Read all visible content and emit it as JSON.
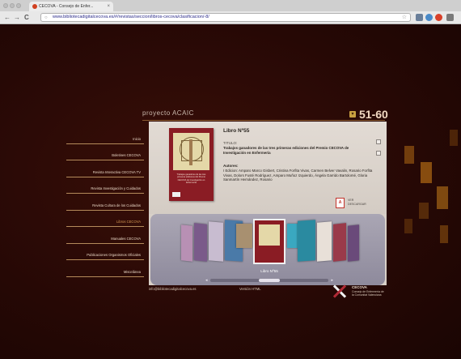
{
  "browser": {
    "tab_title": "CECOVA - Consejo de Enfer...",
    "tab_close": "×",
    "url": "www.bibliotecadigitalcecova.es/#/revistas/seccion/libros-cecova/clasificacion/-8/",
    "back": "←",
    "forward": "→",
    "reload": "C",
    "lock": "○",
    "star": "☆"
  },
  "header": {
    "project_label": "proyecto ACAIC",
    "range_label": "51-60",
    "range_arrow": "▾"
  },
  "menu": {
    "items": [
      {
        "label": "Inicio"
      },
      {
        "label": "Boletines CECOVA"
      },
      {
        "label": "Revista Interactiva CECOVA TV"
      },
      {
        "label": "Revista Investigación y Cuidados"
      },
      {
        "label": "Revista Cultura de los Cuidados"
      },
      {
        "label": "Libros CECOVA"
      },
      {
        "label": "Manuales CECOVA"
      },
      {
        "label": "Publicaciones Organismos Oficiales"
      },
      {
        "label": "Miscelánea"
      }
    ]
  },
  "book": {
    "heading": "Libro Nº55",
    "title_label": "TITULO:",
    "title": "Trabajos ganadores de las tres primeras ediciones del Premio CECOVA de Investigación en Enfermería",
    "authors_label": "Autores:",
    "authors": "I Edicion: Amparo Marco Gisbert, Cristina Forfita Vivas, Carmen Belver Vavalin, Rosario Forfita Vivas, Dolors Fusté Rodríguez, Amparo Muñoz Izquierdo, Ángela Garrido Bartolomé, Gloria Sanmartín Hernández, Rosario",
    "cover_text": "Trabajos ganadores de las tres primeras ediciones del Premio CECOVA de Investigación en Enfermería",
    "pdf_icon_text": "A",
    "pdf_label_line1": "VER",
    "pdf_label_line2": "DESCARGAR"
  },
  "carousel": {
    "caption": "Libro Nº55",
    "left_arrow": "◂",
    "right_arrow": "▸"
  },
  "footer": {
    "email": "info@bibliotecadigitalcecova.es",
    "html_version": "Versión HTML",
    "org_name": "CECOVA",
    "org_sub_line1": "Consejo de Enfermería de",
    "org_sub_line2": "la Comunitat Valenciana"
  }
}
